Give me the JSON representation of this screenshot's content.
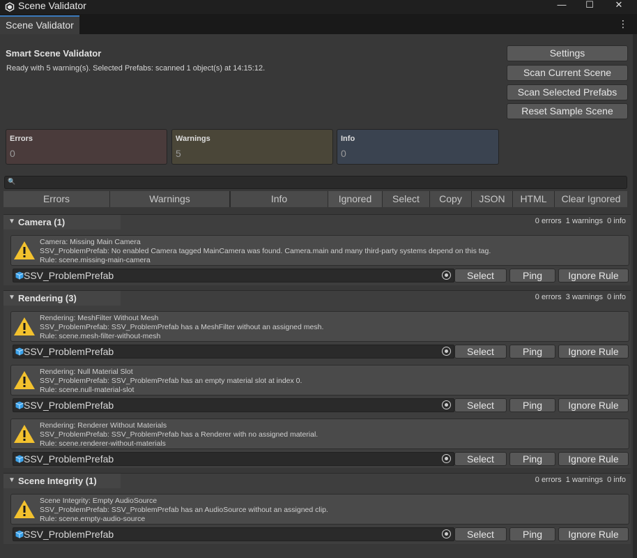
{
  "window": {
    "title": "Scene Validator",
    "min_glyph": "—",
    "max_glyph": "☐",
    "close_glyph": "✕"
  },
  "tab": {
    "label": "Scene Validator",
    "menu_glyph": "⋮"
  },
  "header": {
    "title": "Smart Scene Validator",
    "status": "Ready with 5 warning(s). Selected Prefabs: scanned 1 object(s) at 14:15:12."
  },
  "side_buttons": {
    "settings": "Settings",
    "scan_scene": "Scan Current Scene",
    "scan_prefabs": "Scan Selected Prefabs",
    "reset": "Reset Sample Scene"
  },
  "stats": {
    "errors": {
      "label": "Errors",
      "value": "0",
      "color": "#4a3b3b"
    },
    "warnings": {
      "label": "Warnings",
      "value": "5",
      "color": "#4a4638"
    },
    "info": {
      "label": "Info",
      "value": "0",
      "color": "#3a4350"
    }
  },
  "search": {
    "icon": "search-icon",
    "glyph": "🔍",
    "value": ""
  },
  "toolbar": {
    "errors": "Errors",
    "warnings": "Warnings",
    "info": "Info",
    "ignored": "Ignored",
    "select": "Select",
    "copy": "Copy",
    "json": "JSON",
    "html": "HTML",
    "clear_ignored": "Clear Ignored"
  },
  "groups": [
    {
      "name": "Camera (1)",
      "counts": "0 errors  1 warnings  0 info",
      "issues": [
        {
          "title": "Camera: Missing Main Camera",
          "detail": "SSV_ProblemPrefab: No enabled Camera tagged MainCamera was found. Camera.main and many third-party systems depend on this tag.",
          "rule": "Rule: scene.missing-main-camera",
          "object": "SSV_ProblemPrefab"
        }
      ]
    },
    {
      "name": "Rendering (3)",
      "counts": "0 errors  3 warnings  0 info",
      "issues": [
        {
          "title": "Rendering: MeshFilter Without Mesh",
          "detail": "SSV_ProblemPrefab: SSV_ProblemPrefab has a MeshFilter without an assigned mesh.",
          "rule": "Rule: scene.mesh-filter-without-mesh",
          "object": "SSV_ProblemPrefab"
        },
        {
          "title": "Rendering: Null Material Slot",
          "detail": "SSV_ProblemPrefab: SSV_ProblemPrefab has an empty material slot at index 0.",
          "rule": "Rule: scene.null-material-slot",
          "object": "SSV_ProblemPrefab"
        },
        {
          "title": "Rendering: Renderer Without Materials",
          "detail": "SSV_ProblemPrefab: SSV_ProblemPrefab has a Renderer with no assigned material.",
          "rule": "Rule: scene.renderer-without-materials",
          "object": "SSV_ProblemPrefab"
        }
      ]
    },
    {
      "name": "Scene Integrity (1)",
      "counts": "0 errors  1 warnings  0 info",
      "issues": [
        {
          "title": "Scene Integrity: Empty AudioSource",
          "detail": "SSV_ProblemPrefab: SSV_ProblemPrefab has an AudioSource without an assigned clip.",
          "rule": "Rule: scene.empty-audio-source",
          "object": "SSV_ProblemPrefab"
        }
      ]
    }
  ],
  "issue_buttons": {
    "select": "Select",
    "ping": "Ping",
    "ignore": "Ignore Rule"
  },
  "colors": {
    "accent": "#3a79bb",
    "warning": "#f2c12e",
    "prefab": "#3aa0e8"
  }
}
